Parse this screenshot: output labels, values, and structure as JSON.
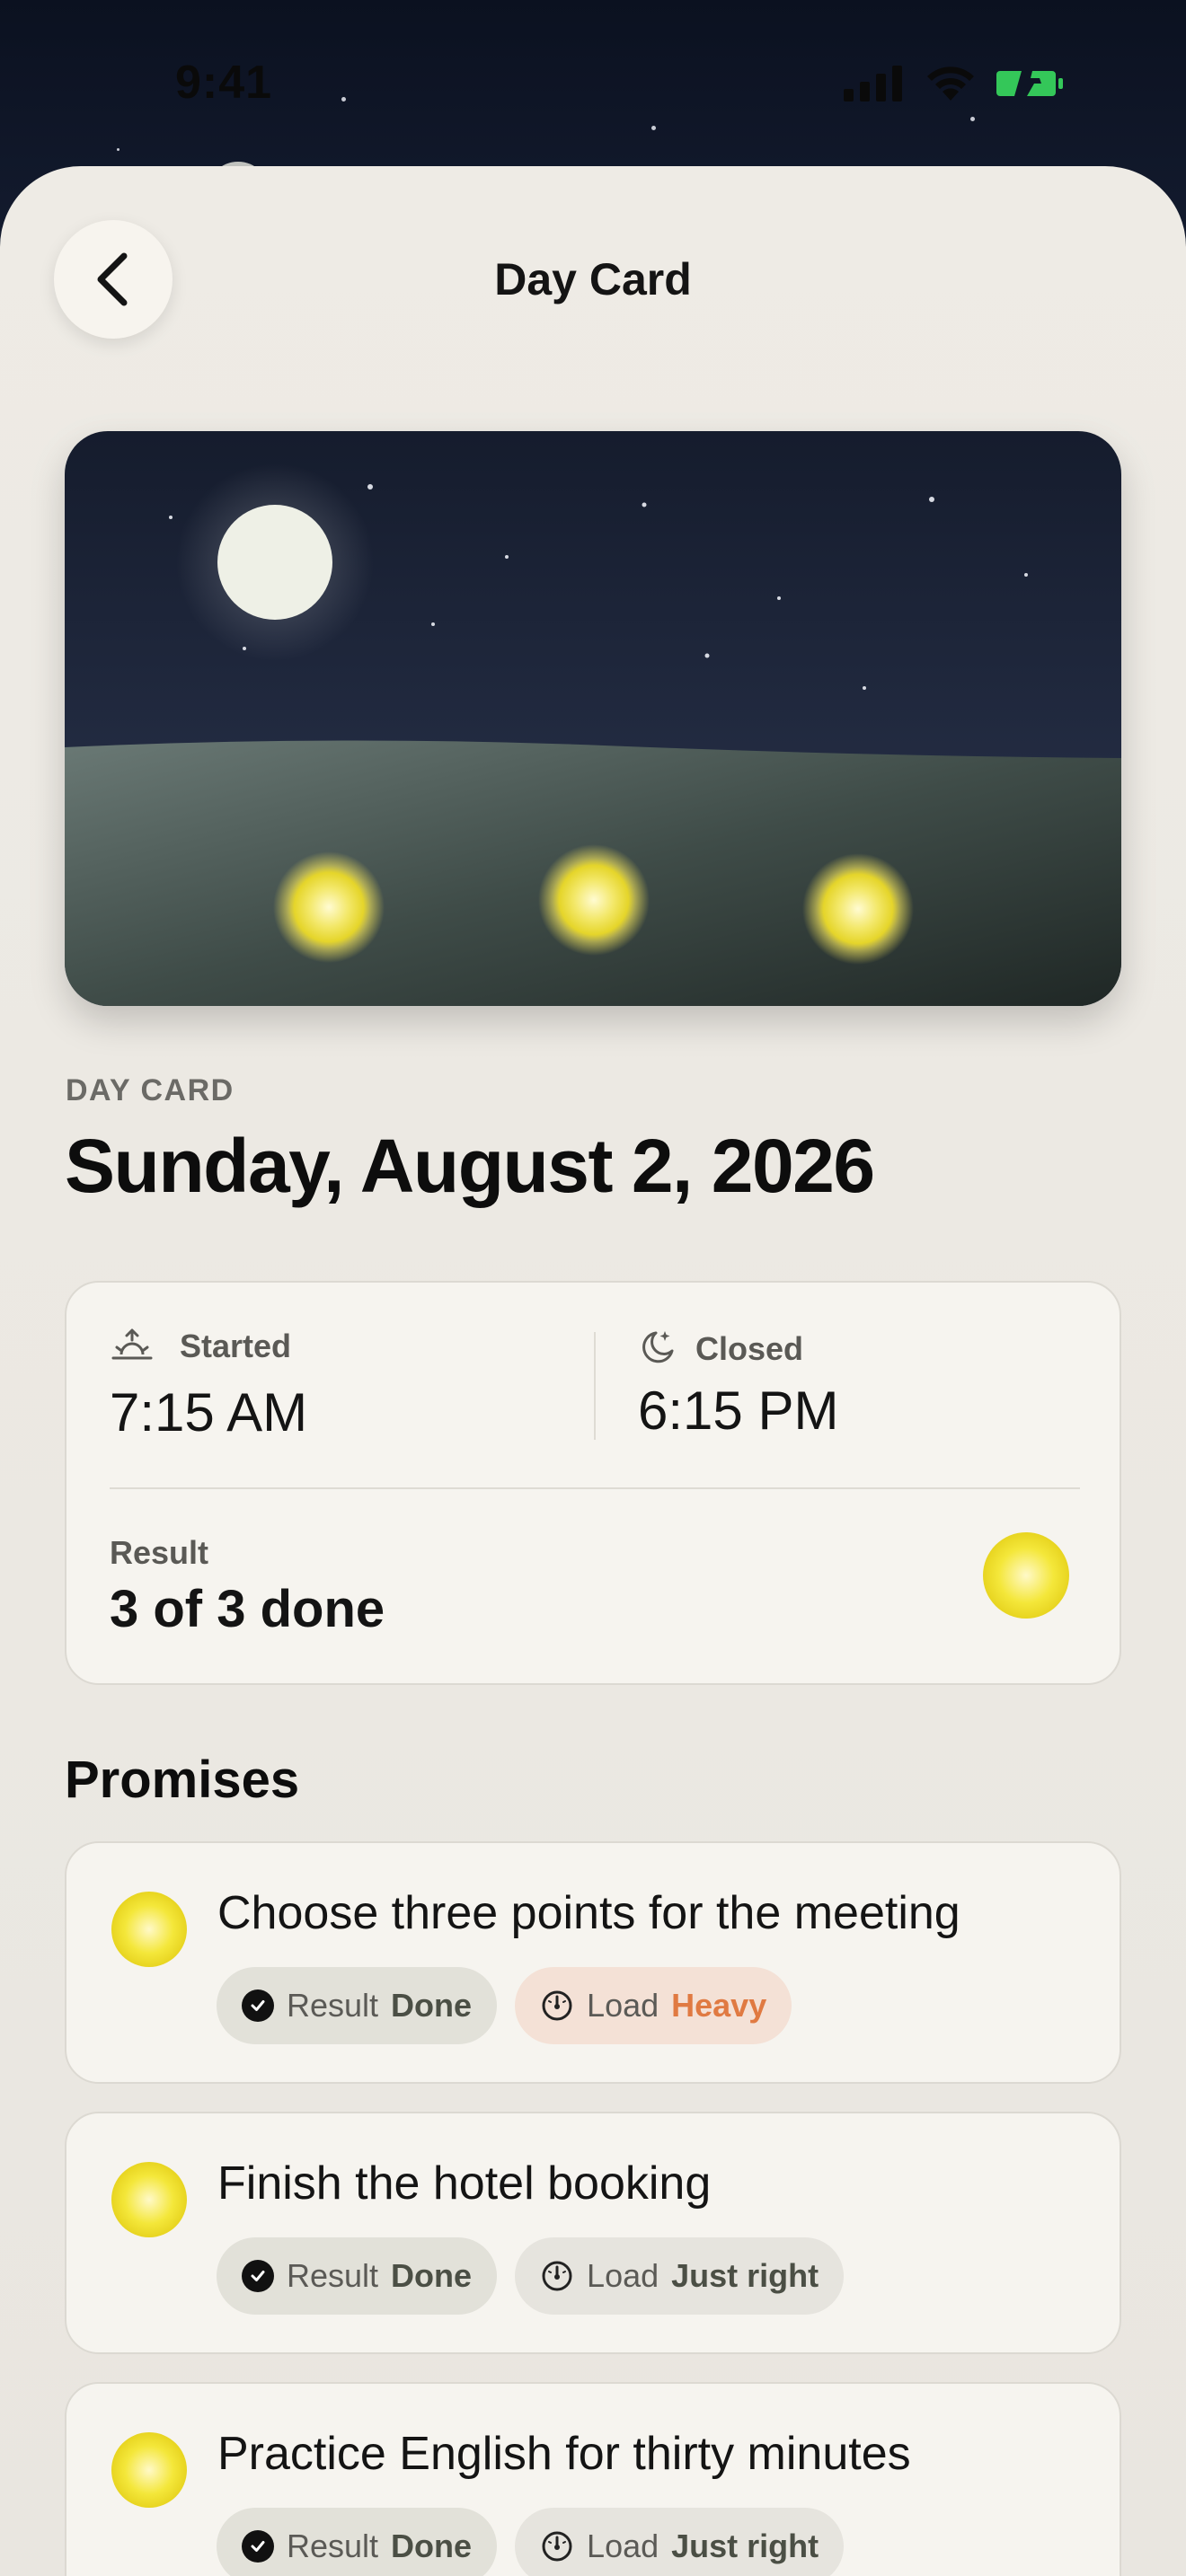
{
  "status_bar": {
    "time": "9:41"
  },
  "nav": {
    "title": "Day Card",
    "back_icon": "chevron-left-icon"
  },
  "hero": {
    "description_icon": "night-landscape",
    "orb_count": 3
  },
  "header": {
    "section_label": "DAY CARD",
    "date": "Sunday, August 2, 2026"
  },
  "summary": {
    "started_label": "Started",
    "started_value": "7:15 AM",
    "started_icon": "sunrise-icon",
    "closed_label": "Closed",
    "closed_value": "6:15 PM",
    "closed_icon": "moon-stars-icon",
    "result_label": "Result",
    "result_value": "3 of 3 done"
  },
  "promises": {
    "heading": "Promises",
    "items": [
      {
        "title": "Choose three points for the meeting",
        "result_key": "Result",
        "result_value": "Done",
        "load_key": "Load",
        "load_value": "Heavy"
      },
      {
        "title": "Finish the hotel booking",
        "result_key": "Result",
        "result_value": "Done",
        "load_key": "Load",
        "load_value": "Just right"
      },
      {
        "title": "Practice English for thirty minutes",
        "result_key": "Result",
        "result_value": "Done",
        "load_key": "Load",
        "load_value": "Just right"
      }
    ]
  },
  "colors": {
    "accent_heavy": "#e07a42",
    "glow": "#f4e73a",
    "battery": "#34c759"
  }
}
